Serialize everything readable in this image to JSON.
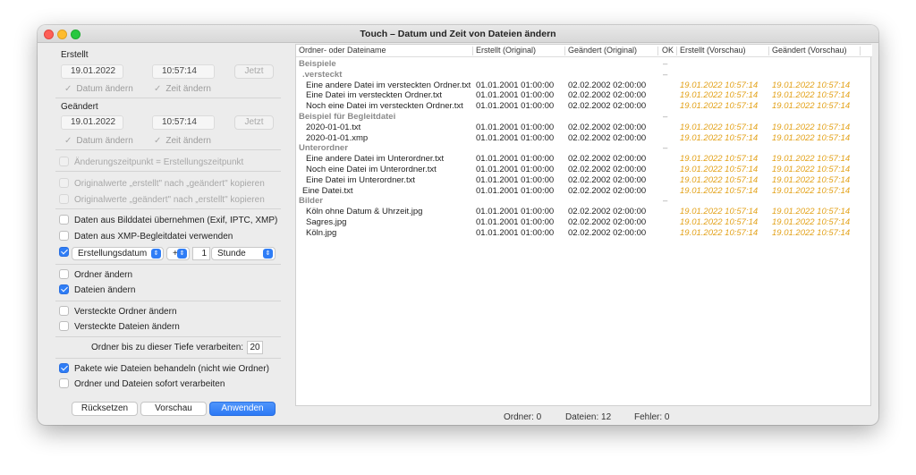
{
  "window": {
    "title": "Touch – Datum und Zeit von Dateien ändern"
  },
  "erstellt": {
    "heading": "Erstellt",
    "date": "19.01.2022",
    "time": "10:57:14",
    "now_button": "Jetzt",
    "change_date": "Datum ändern",
    "change_time": "Zeit ändern"
  },
  "geaendert": {
    "heading": "Geändert",
    "date": "19.01.2022",
    "time": "10:57:14",
    "now_button": "Jetzt",
    "change_date": "Datum ändern",
    "change_time": "Zeit ändern"
  },
  "options": {
    "change_time_equals_created": "Änderungszeitpunkt = Erstellungszeitpunkt",
    "copy_created_to_modified": "Originalwerte „erstellt\" nach „geändert\" kopieren",
    "copy_modified_to_created": "Originalwerte „geändert\" nach „erstellt\" kopieren",
    "use_image_data": "Daten aus Bilddatei übernehmen (Exif, IPTC, XMP)",
    "use_xmp_sidecar": "Daten aus XMP-Begleitdatei verwenden",
    "offset_field": "Erstellungsdatum",
    "offset_sign": "+",
    "offset_amount": "1",
    "offset_unit": "Stunde",
    "change_folders": "Ordner ändern",
    "change_files": "Dateien ändern",
    "change_hidden_folders": "Versteckte Ordner ändern",
    "change_hidden_files": "Versteckte Dateien ändern",
    "depth_label": "Ordner bis zu dieser Tiefe verarbeiten:",
    "depth_value": "20",
    "packages_as_files": "Pakete wie Dateien behandeln (nicht wie Ordner)",
    "process_immediately": "Ordner und Dateien sofort verarbeiten"
  },
  "checked": {
    "use_image_data": false,
    "use_xmp_sidecar": false,
    "offset_enabled": true,
    "change_folders": false,
    "change_files": true,
    "change_hidden_folders": false,
    "change_hidden_files": false,
    "packages_as_files": true,
    "process_immediately": false
  },
  "buttons": {
    "reset": "Rücksetzen",
    "preview": "Vorschau",
    "apply": "Anwenden"
  },
  "table": {
    "headers": [
      "Ordner- oder Dateiname",
      "Erstellt (Original)",
      "Geändert (Original)",
      "OK",
      "Erstellt (Vorschau)",
      "Geändert (Vorschau)"
    ],
    "rows": [
      {
        "kind": "group",
        "name": "Beispiele",
        "ok": "–"
      },
      {
        "kind": "group",
        "name": ".versteckt",
        "ok": "–"
      },
      {
        "kind": "file",
        "name": "Eine andere Datei im versteckten Ordner.txt",
        "created": "01.01.2001  01:00:00",
        "modified": "02.02.2002  02:00:00",
        "ok": "",
        "prev_created": "19.01.2022  10:57:14",
        "prev_modified": "19.01.2022  10:57:14"
      },
      {
        "kind": "file",
        "name": "Eine Datei im versteckten Ordner.txt",
        "created": "01.01.2001  01:00:00",
        "modified": "02.02.2002  02:00:00",
        "ok": "",
        "prev_created": "19.01.2022  10:57:14",
        "prev_modified": "19.01.2022  10:57:14"
      },
      {
        "kind": "file",
        "name": "Noch eine Datei im versteckten Ordner.txt",
        "created": "01.01.2001  01:00:00",
        "modified": "02.02.2002  02:00:00",
        "ok": "",
        "prev_created": "19.01.2022  10:57:14",
        "prev_modified": "19.01.2022  10:57:14"
      },
      {
        "kind": "group",
        "name": "Beispiel für Begleitdatei",
        "ok": "–"
      },
      {
        "kind": "file",
        "name": "2020-01-01.txt",
        "created": "01.01.2001  01:00:00",
        "modified": "02.02.2002  02:00:00",
        "ok": "",
        "prev_created": "19.01.2022  10:57:14",
        "prev_modified": "19.01.2022  10:57:14"
      },
      {
        "kind": "file",
        "name": "2020-01-01.xmp",
        "created": "01.01.2001  01:00:00",
        "modified": "02.02.2002  02:00:00",
        "ok": "",
        "prev_created": "19.01.2022  10:57:14",
        "prev_modified": "19.01.2022  10:57:14"
      },
      {
        "kind": "group",
        "name": "Unterordner",
        "ok": "–"
      },
      {
        "kind": "file",
        "name": "Eine andere Datei im Unterordner.txt",
        "created": "01.01.2001  01:00:00",
        "modified": "02.02.2002  02:00:00",
        "ok": "",
        "prev_created": "19.01.2022  10:57:14",
        "prev_modified": "19.01.2022  10:57:14"
      },
      {
        "kind": "file",
        "name": "Noch eine Datei im Unterordner.txt",
        "created": "01.01.2001  01:00:00",
        "modified": "02.02.2002  02:00:00",
        "ok": "",
        "prev_created": "19.01.2022  10:57:14",
        "prev_modified": "19.01.2022  10:57:14"
      },
      {
        "kind": "file",
        "name": "Eine Datei im Unterordner.txt",
        "created": "01.01.2001  01:00:00",
        "modified": "02.02.2002  02:00:00",
        "ok": "",
        "prev_created": "19.01.2022  10:57:14",
        "prev_modified": "19.01.2022  10:57:14"
      },
      {
        "kind": "file",
        "name": "Eine Datei.txt",
        "created": "01.01.2001  01:00:00",
        "modified": "02.02.2002  02:00:00",
        "ok": "",
        "prev_created": "19.01.2022  10:57:14",
        "prev_modified": "19.01.2022  10:57:14"
      },
      {
        "kind": "group",
        "name": "Bilder",
        "ok": "–"
      },
      {
        "kind": "file",
        "name": "Köln ohne Datum & Uhrzeit.jpg",
        "created": "01.01.2001  01:00:00",
        "modified": "02.02.2002  02:00:00",
        "ok": "",
        "prev_created": "19.01.2022  10:57:14",
        "prev_modified": "19.01.2022  10:57:14"
      },
      {
        "kind": "file",
        "name": "Sagres.jpg",
        "created": "01.01.2001  01:00:00",
        "modified": "02.02.2002  02:00:00",
        "ok": "",
        "prev_created": "19.01.2022  10:57:14",
        "prev_modified": "19.01.2022  10:57:14"
      },
      {
        "kind": "file",
        "name": "Köln.jpg",
        "created": "01.01.2001  01:00:00",
        "modified": "02.02.2002  02:00:00",
        "ok": "",
        "prev_created": "19.01.2022  10:57:14",
        "prev_modified": "19.01.2022  10:57:14"
      }
    ]
  },
  "status": {
    "folders": "Ordner: 0",
    "files": "Dateien: 12",
    "errors": "Fehler: 0"
  },
  "colors": {
    "accent": "#2f7df6",
    "preview_text": "#e3a21a",
    "group_text": "#8a8a8a"
  }
}
